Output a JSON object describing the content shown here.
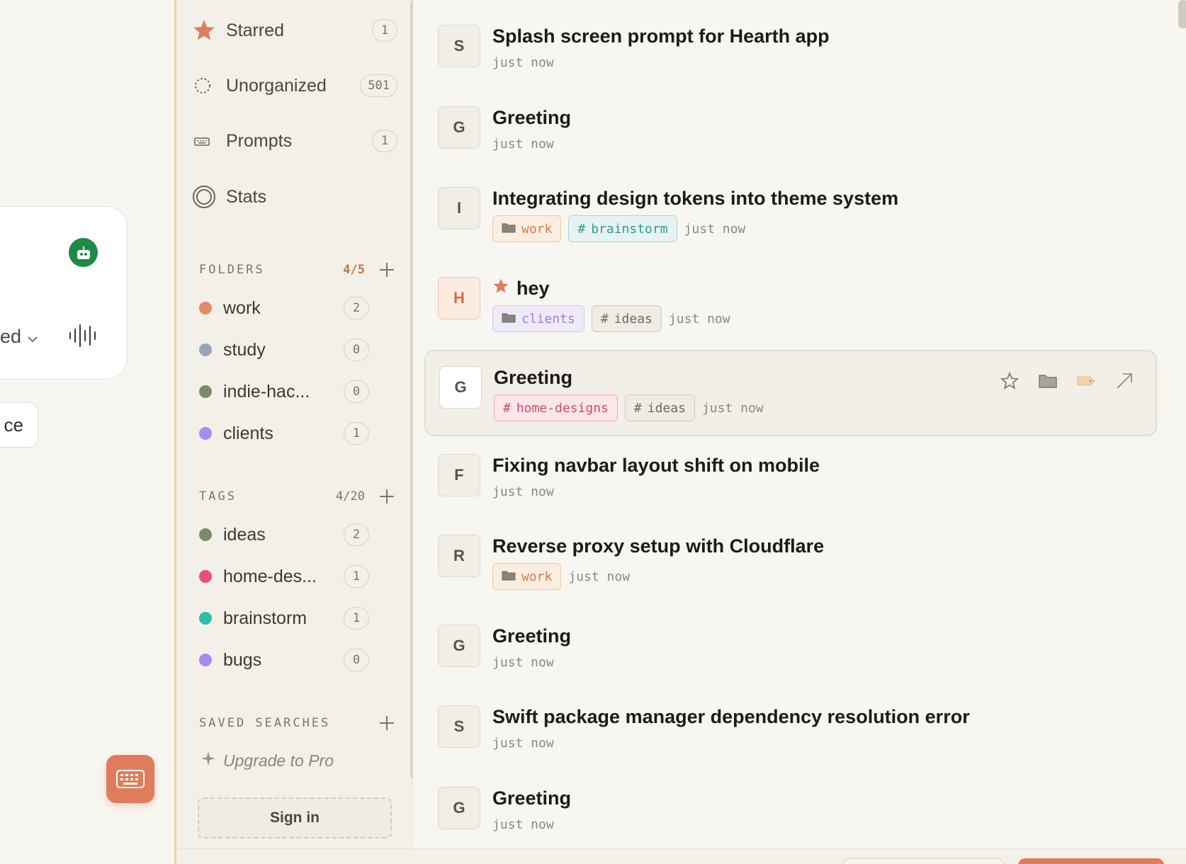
{
  "host": {
    "dropdown_label": "ed",
    "chip_label": "ce"
  },
  "sidebar": {
    "nav": [
      {
        "label": "Starred",
        "count": "1"
      },
      {
        "label": "Unorganized",
        "count": "501"
      },
      {
        "label": "Prompts",
        "count": "1"
      },
      {
        "label": "Stats"
      }
    ],
    "folders": {
      "title": "FOLDERS",
      "count": "4/5",
      "count_color": "#c9723f",
      "items": [
        {
          "label": "work",
          "count": "2",
          "color": "#e48a66"
        },
        {
          "label": "study",
          "count": "0",
          "color": "#9aa3b8"
        },
        {
          "label": "indie-hac...",
          "count": "0",
          "color": "#7d8a6a"
        },
        {
          "label": "clients",
          "count": "1",
          "color": "#a98af0"
        }
      ]
    },
    "tags": {
      "title": "TAGS",
      "count": "4/20",
      "count_color": "#7a766d",
      "items": [
        {
          "label": "ideas",
          "count": "2",
          "color": "#7d8a6a"
        },
        {
          "label": "home-des...",
          "count": "1",
          "color": "#ec4a86"
        },
        {
          "label": "brainstorm",
          "count": "1",
          "color": "#2fbfa8"
        },
        {
          "label": "bugs",
          "count": "0",
          "color": "#a98af0"
        }
      ]
    },
    "saved_searches": {
      "title": "SAVED SEARCHES"
    },
    "upgrade_label": "Upgrade to Pro",
    "signin_label": "Sign in"
  },
  "entries": [
    {
      "initial": "S",
      "title": "Splash screen prompt for Hearth app",
      "time": "just now"
    },
    {
      "initial": "G",
      "title": "Greeting",
      "time": "just now"
    },
    {
      "initial": "I",
      "title": "Integrating design tokens into theme system",
      "folder": "work",
      "tags": [
        "brainstorm"
      ],
      "time": "just now"
    },
    {
      "initial": "H",
      "title": "hey",
      "starred": true,
      "folder": "clients",
      "tags": [
        "ideas"
      ],
      "time": "just now"
    },
    {
      "initial": "G",
      "title": "Greeting",
      "tags": [
        "home-designs",
        "ideas"
      ],
      "time": "just now"
    },
    {
      "initial": "F",
      "title": "Fixing navbar layout shift on mobile",
      "time": "just now"
    },
    {
      "initial": "R",
      "title": "Reverse proxy setup with Cloudflare",
      "folder": "work",
      "time": "just now"
    },
    {
      "initial": "G",
      "title": "Greeting",
      "time": "just now"
    },
    {
      "initial": "S",
      "title": "Swift package manager dependency resolution error",
      "time": "just now"
    },
    {
      "initial": "G",
      "title": "Greeting",
      "time": "just now"
    }
  ],
  "icons": {
    "starred": "star-icon",
    "unorganized": "dashed-circle-icon",
    "prompts": "keyboard-icon",
    "stats": "target-icon",
    "accent": "#e07c5b"
  }
}
